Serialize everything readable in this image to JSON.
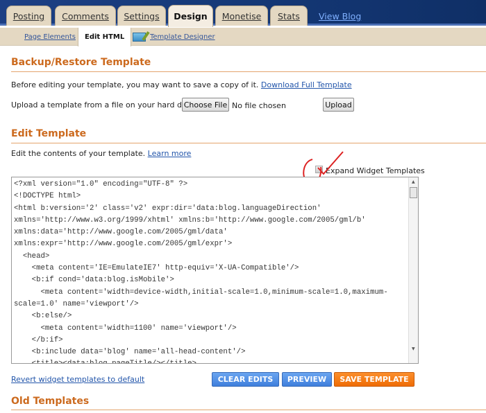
{
  "tabs": [
    {
      "label": "Posting"
    },
    {
      "label": "Comments"
    },
    {
      "label": "Settings"
    },
    {
      "label": "Design",
      "active": true
    },
    {
      "label": "Monetise"
    },
    {
      "label": "Stats"
    }
  ],
  "view_blog": "View Blog",
  "subtabs": {
    "page_elements": "Page Elements",
    "edit_html": "Edit HTML",
    "template_designer": "Template Designer"
  },
  "backup": {
    "title": "Backup/Restore Template",
    "desc": "Before editing your template, you may want to save a copy of it.",
    "download_link": "Download Full Template",
    "upload_label": "Upload a template from a file on your hard drive:",
    "choose_file": "Choose File",
    "no_file": "No file chosen",
    "upload_button": "Upload"
  },
  "edit": {
    "title": "Edit Template",
    "desc": "Edit the contents of your template.",
    "learn_more": "Learn more",
    "expand_widgets": "Expand Widget Templates",
    "expand_checked": false,
    "code": "<?xml version=\"1.0\" encoding=\"UTF-8\" ?>\n<!DOCTYPE html>\n<html b:version='2' class='v2' expr:dir='data:blog.languageDirection'\nxmlns='http://www.w3.org/1999/xhtml' xmlns:b='http://www.google.com/2005/gml/b'\nxmlns:data='http://www.google.com/2005/gml/data'\nxmlns:expr='http://www.google.com/2005/gml/expr'>\n  <head>\n    <meta content='IE=EmulateIE7' http-equiv='X-UA-Compatible'/>\n    <b:if cond='data:blog.isMobile'>\n      <meta content='width=device-width,initial-scale=1.0,minimum-scale=1.0,maximum-\nscale=1.0' name='viewport'/>\n    <b:else/>\n      <meta content='width=1100' name='viewport'/>\n    </b:if>\n    <b:include data='blog' name='all-head-content'/>\n    <title><data:blog.pageTitle/></title>\n\n    <b:skin><![CDATA[/*-----------------------------------------------\n\nBlogger Template Style",
    "revert_link": "Revert widget templates to default",
    "clear_edits": "CLEAR EDITS",
    "preview": "PREVIEW",
    "save": "SAVE TEMPLATE"
  },
  "old": {
    "title": "Old Templates"
  },
  "colors": {
    "accent": "#cc6a1e",
    "blue_button": "#4f8fe6",
    "orange_button": "#f7790f"
  }
}
